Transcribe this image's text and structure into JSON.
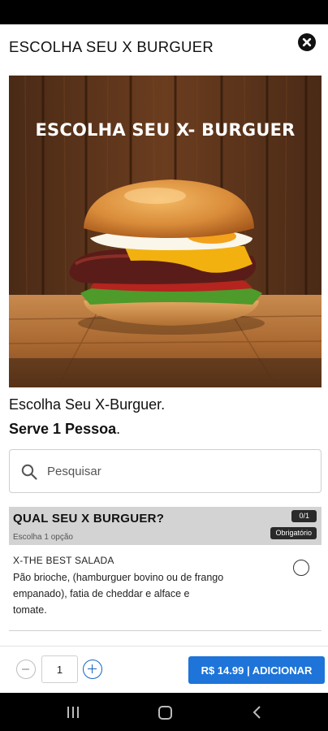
{
  "header": {
    "title": "ESCOLHA SEU X BURGUER"
  },
  "hero": {
    "caption": "ESCOLHA SEU X- BURGUER"
  },
  "product": {
    "description": "Escolha Seu X-Burguer.",
    "serves_bold": "Serve 1 Pessoa",
    "serves_suffix": "."
  },
  "search": {
    "placeholder": "Pesquisar"
  },
  "option_group": {
    "title": "QUAL SEU X BURGUER?",
    "subtitle": "Escolha 1 opção",
    "count": "0/1",
    "required": "Obrigatório",
    "items": [
      {
        "name": "X-THE BEST SALADA",
        "description": "Pão brioche, (hamburguer bovino ou de frango empanado), fatia de cheddar e alface e tomate."
      }
    ]
  },
  "footer": {
    "quantity": "1",
    "add_label": "R$ 14.99 | ADICIONAR"
  },
  "colors": {
    "accent": "#1e74d8",
    "plus_icon": "#1565c0",
    "group_header_bg": "#d3d3d3",
    "badge_bg": "#2a2a2a"
  },
  "icons": {
    "close": "close-icon",
    "search": "search-icon",
    "minus": "minus-icon",
    "plus": "plus-icon",
    "nav_recent": "recent-apps-icon",
    "nav_home": "home-icon",
    "nav_back": "back-icon"
  }
}
